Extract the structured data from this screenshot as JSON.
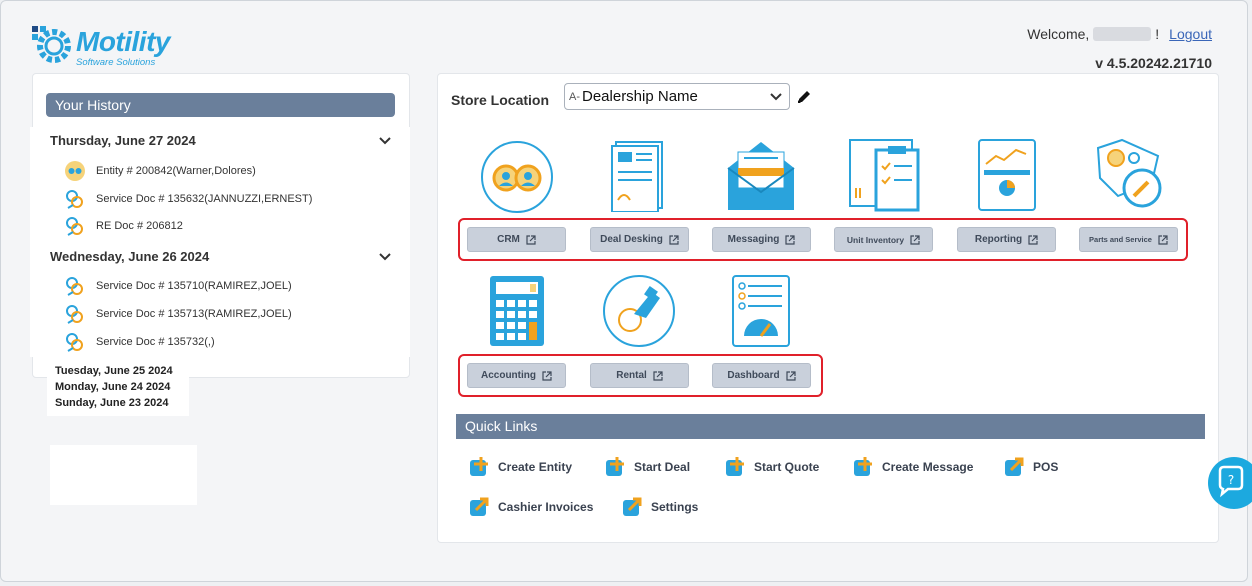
{
  "header": {
    "logo_text": "Motility",
    "logo_sub": "Software Solutions",
    "welcome_prefix": "Welcome,",
    "welcome_suffix": "!",
    "logout_label": "Logout",
    "version": "v 4.5.20242.21710"
  },
  "history": {
    "title": "Your History",
    "days": [
      {
        "label": "Thursday, June 27 2024",
        "items": [
          {
            "label": "Entity # 200842(Warner,Dolores)",
            "icon": "entity-icon"
          },
          {
            "label": "Service Doc # 135632(JANNUZZI,ERNEST)",
            "icon": "service-doc-icon"
          },
          {
            "label": "RE Doc # 206812",
            "icon": "re-doc-icon"
          }
        ]
      },
      {
        "label": "Wednesday, June 26 2024",
        "items": [
          {
            "label": "Service Doc # 135710(RAMIREZ,JOEL)",
            "icon": "service-doc-icon"
          },
          {
            "label": "Service Doc # 135713(RAMIREZ,JOEL)",
            "icon": "service-doc-icon"
          },
          {
            "label": "Service Doc # 135732(,)",
            "icon": "service-doc-icon"
          }
        ]
      }
    ],
    "collapsed_days": [
      "Tuesday, June 25 2024",
      "Monday, June 24 2024",
      "Sunday, June 23 2024"
    ]
  },
  "store": {
    "label": "Store Location",
    "prefix": "A-",
    "value": "Dealership Name"
  },
  "modules": [
    {
      "label": "CRM",
      "icon": "crm-icon"
    },
    {
      "label": "Deal Desking",
      "icon": "deal-desking-icon"
    },
    {
      "label": "Messaging",
      "icon": "messaging-icon"
    },
    {
      "label": "Unit Inventory",
      "icon": "unit-inventory-icon"
    },
    {
      "label": "Reporting",
      "icon": "reporting-icon"
    },
    {
      "label": "Parts and Service",
      "icon": "parts-service-icon"
    },
    {
      "label": "Accounting",
      "icon": "accounting-icon"
    },
    {
      "label": "Rental",
      "icon": "rental-icon"
    },
    {
      "label": "Dashboard",
      "icon": "dashboard-icon"
    }
  ],
  "quick_links": {
    "title": "Quick Links",
    "items": [
      {
        "label": "Create Entity",
        "icon": "plus-icon"
      },
      {
        "label": "Start Deal",
        "icon": "plus-icon"
      },
      {
        "label": "Start Quote",
        "icon": "plus-icon"
      },
      {
        "label": "Create Message",
        "icon": "plus-icon"
      },
      {
        "label": "POS",
        "icon": "launch-icon"
      },
      {
        "label": "Cashier Invoices",
        "icon": "launch-icon"
      },
      {
        "label": "Settings",
        "icon": "launch-icon"
      }
    ]
  },
  "colors": {
    "brand": "#2aa3dc",
    "accent_orange": "#f0a21e",
    "header_bar": "#6a7f9b",
    "highlight_red": "#e0202a"
  }
}
